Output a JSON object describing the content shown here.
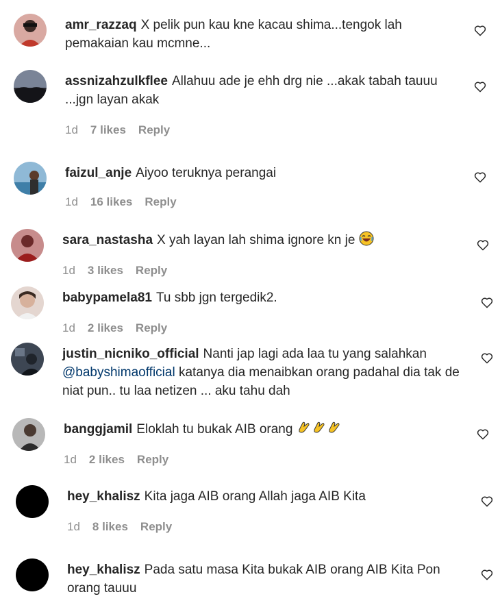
{
  "comments": [
    {
      "user": "amr_razzaq",
      "text": "X pelik pun kau kne kacau shima...tengok lah pemakaian kau mcmne..."
    },
    {
      "user": "assnizahzulkflee",
      "text": "Allahuu ade je ehh drg nie ...akak tabah tauuu ...jgn layan akak",
      "time": "1d",
      "likes": "7 likes",
      "reply": "Reply"
    },
    {
      "user": "faizul_anje",
      "text": "Aiyoo teruknya perangai",
      "time": "1d",
      "likes": "16 likes",
      "reply": "Reply"
    },
    {
      "user": "sara_nastasha",
      "text": "X yah layan lah shima ignore kn je",
      "time": "1d",
      "likes": "3 likes",
      "reply": "Reply"
    },
    {
      "user": "babypamela81",
      "text": "Tu sbb jgn tergedik2.",
      "time": "1d",
      "likes": "2 likes",
      "reply": "Reply"
    },
    {
      "user": "justin_nicniko_official",
      "text_before": "Nanti jap lagi ada laa tu yang salahkan",
      "mention": "@babyshimaofficial",
      "text_after": "katanya dia menaibkan orang padahal dia tak de niat pun.. tu laa netizen ... aku tahu dah"
    },
    {
      "user": "banggjamil",
      "text": "Eloklah tu bukak AIB orang",
      "time": "1d",
      "likes": "2 likes",
      "reply": "Reply"
    },
    {
      "user": "hey_khalisz",
      "text": "Kita jaga AIB orang Allah jaga AIB Kita",
      "time": "1d",
      "likes": "8 likes",
      "reply": "Reply"
    },
    {
      "user": "hey_khalisz",
      "text": "Pada satu masa Kita bukak AIB orang AIB Kita Pon orang tauuu"
    }
  ],
  "colors": {
    "text": "#262626",
    "meta": "#8e8e8e",
    "mention": "#00376b"
  }
}
